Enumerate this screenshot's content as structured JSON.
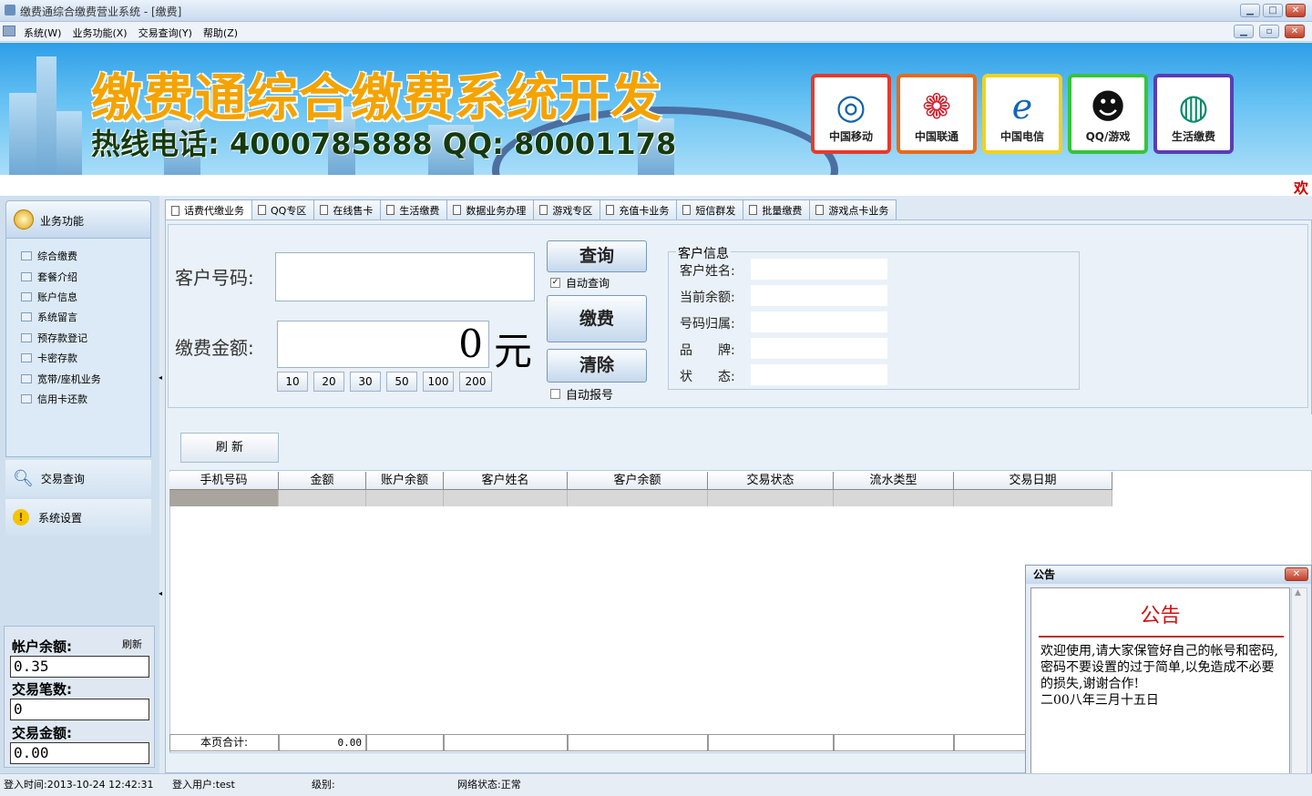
{
  "window": {
    "title": "缴费通综合缴费营业系统 - [缴费]"
  },
  "menu": [
    "系统(W)",
    "业务功能(X)",
    "交易查询(Y)",
    "帮助(Z)"
  ],
  "banner": {
    "title": "缴费通综合缴费系统开发",
    "hotline": "热线电话: 4000785888 QQ: 80001178",
    "logos": [
      {
        "label": "中国移动",
        "symbol": "◎",
        "color": "#e63a2b",
        "symcolor": "#1262a8"
      },
      {
        "label": "中国联通",
        "symbol": "❁",
        "color": "#e86a1a",
        "symcolor": "#d0212e"
      },
      {
        "label": "中国电信",
        "symbol": "ℯ",
        "color": "#f2d21c",
        "symcolor": "#1465b5"
      },
      {
        "label": "QQ/游戏",
        "symbol": "☻",
        "color": "#36c43a",
        "symcolor": "#111"
      },
      {
        "label": "生活缴费",
        "symbol": "◍",
        "color": "#5a3db5",
        "symcolor": "#0b8a6a"
      }
    ],
    "marquee": "欢"
  },
  "sidebar": {
    "header": "业务功能",
    "items": [
      "综合缴费",
      "套餐介绍",
      "账户信息",
      "系统留言",
      "预存款登记",
      "卡密存款",
      "宽带/座机业务",
      "信用卡还款"
    ],
    "group1": "交易查询",
    "group2": "系统设置"
  },
  "account": {
    "balance_label": "帐户余额:",
    "refresh": "刷新",
    "balance": "0.35",
    "count_label": "交易笔数:",
    "count": "0",
    "amount_label": "交易金额:",
    "amount": "0.00"
  },
  "tabs": [
    "话费代缴业务",
    "QQ专区",
    "在线售卡",
    "生活缴费",
    "数据业务办理",
    "游戏专区",
    "充值卡业务",
    "短信群发",
    "批量缴费",
    "游戏点卡业务"
  ],
  "form": {
    "customer_label": "客户号码:",
    "customer_value": "",
    "amount_label": "缴费金额:",
    "amount_value": "0",
    "unit": "元",
    "quick": [
      "10",
      "20",
      "30",
      "50",
      "100",
      "200"
    ],
    "query": "查询",
    "auto_query": "自动查询",
    "pay": "缴费",
    "clear": "清除",
    "auto_report": "自动报号"
  },
  "customer_info": {
    "title": "客户信息",
    "fields": [
      "客户姓名:",
      "当前余额:",
      "号码归属:",
      "品　　牌:",
      "状　　态:"
    ]
  },
  "grid": {
    "refresh": "刷 新",
    "columns": [
      "手机号码",
      "金额",
      "账户余额",
      "客户姓名",
      "客户余额",
      "交易状态",
      "流水类型",
      "交易日期"
    ],
    "footer_label": "本页合计:",
    "footer_total": "0.00"
  },
  "notice": {
    "window_title": "公告",
    "heading": "公告",
    "text": "欢迎使用,请大家保管好自己的帐号和密码,密码不要设置的过于简单,以免造成不必要的损失,谢谢合作!",
    "date": "二00八年三月十五日"
  },
  "status": {
    "login_time": "登入时间:2013-10-24 12:42:31",
    "login_user": "登入用户:test",
    "level": "级别:",
    "network": "网络状态:正常"
  }
}
